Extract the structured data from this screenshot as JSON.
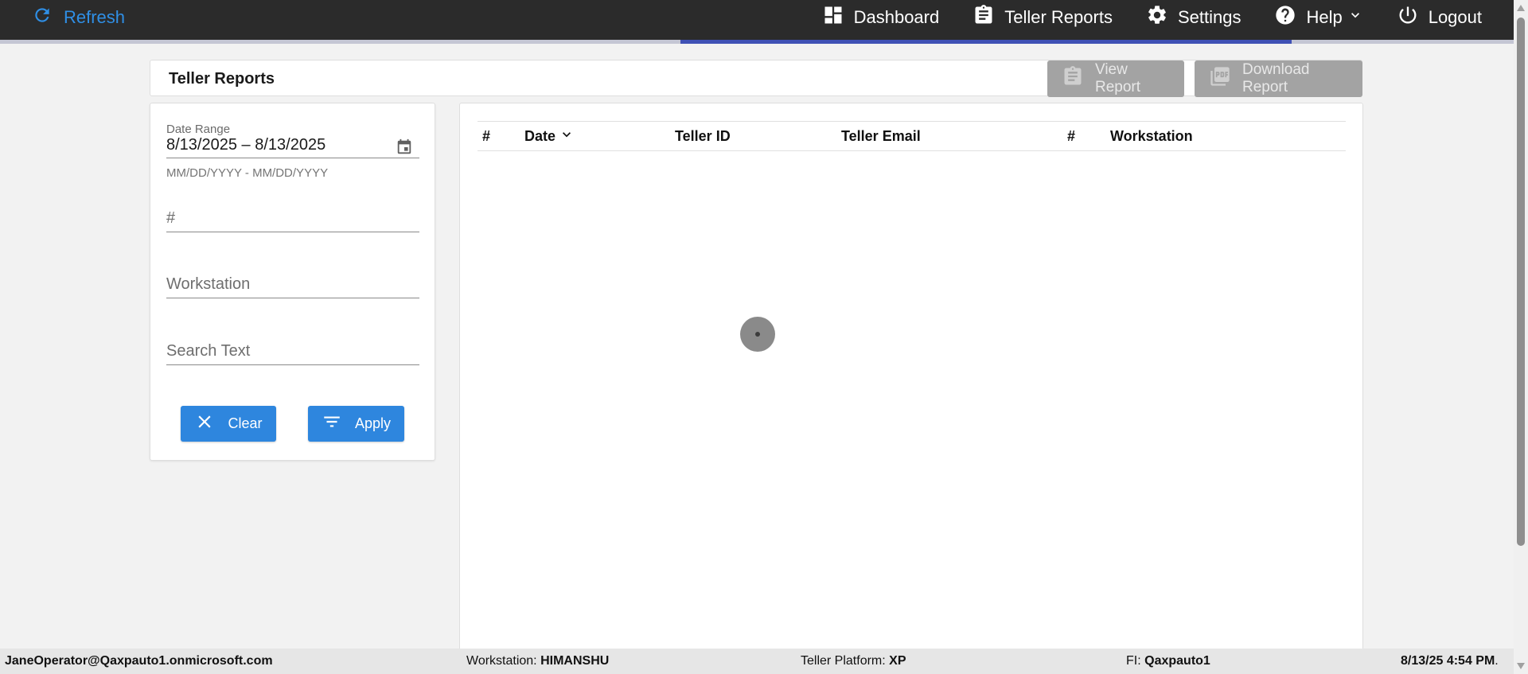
{
  "topbar": {
    "refresh_label": "Refresh",
    "nav": [
      {
        "label": "Dashboard",
        "icon": "dashboard-icon"
      },
      {
        "label": "Teller Reports",
        "icon": "clipboard-icon"
      },
      {
        "label": "Settings",
        "icon": "gear-icon"
      },
      {
        "label": "Help",
        "icon": "help-icon"
      },
      {
        "label": "Logout",
        "icon": "power-icon"
      }
    ],
    "active_item": "Teller Reports"
  },
  "header": {
    "title": "Teller Reports",
    "view_report_label": "View Report",
    "download_report_label": "Download Report"
  },
  "filters": {
    "date_range_label": "Date Range",
    "date_range_value": "8/13/2025 – 8/13/2025",
    "date_range_hint": "MM/DD/YYYY - MM/DD/YYYY",
    "number_placeholder": "#",
    "workstation_placeholder": "Workstation",
    "search_placeholder": "Search Text",
    "clear_label": "Clear",
    "apply_label": "Apply"
  },
  "table": {
    "columns": [
      "#",
      "Date",
      "Teller ID",
      "Teller Email",
      "#",
      "Workstation"
    ],
    "sorted_column": "Date",
    "rows": [],
    "loading": true
  },
  "status": {
    "user": "JaneOperator@Qaxpauto1.onmicrosoft.com",
    "workstation_label": "Workstation:",
    "workstation_value": "HIMANSHU",
    "platform_label": "Teller Platform:",
    "platform_value": "XP",
    "fi_label": "FI:",
    "fi_value": "Qaxpauto1",
    "datetime": "8/13/25 4:54 PM",
    "datetime_suffix": "."
  },
  "colors": {
    "topbar_bg": "#2b2b2b",
    "accent_blue": "#2e86de",
    "active_underline": "#3f51b5",
    "refresh_blue": "#2f8fe6",
    "disabled_button": "#a3a3a3"
  }
}
